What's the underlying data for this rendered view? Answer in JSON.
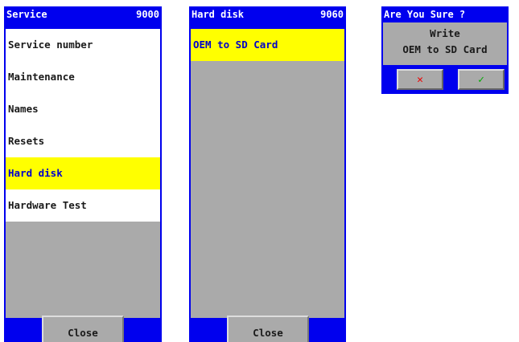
{
  "service_screen": {
    "title": "Service",
    "code": "9000",
    "menu": [
      {
        "label": "Service number",
        "selected": false
      },
      {
        "label": "Maintenance",
        "selected": false
      },
      {
        "label": "Names",
        "selected": false
      },
      {
        "label": "Resets",
        "selected": false
      },
      {
        "label": "Hard disk",
        "selected": true
      },
      {
        "label": "Hardware Test",
        "selected": false
      }
    ],
    "close_label": "Close"
  },
  "hard_disk_screen": {
    "title": "Hard disk",
    "code": "9060",
    "menu": [
      {
        "label": "OEM to SD Card",
        "selected": true
      }
    ],
    "close_label": "Close"
  },
  "confirm_dialog": {
    "title": "Are You Sure ?",
    "message_line1": "Write",
    "message_line2": "OEM to SD Card",
    "cancel_icon": "close-icon",
    "ok_icon": "check-icon"
  },
  "colors": {
    "frame": "#0000ee",
    "selected_bg": "#ffff00",
    "selected_text": "#0000cc",
    "empty_area": "#aaaaaa",
    "cancel": "#ee0000",
    "ok": "#00aa00"
  }
}
